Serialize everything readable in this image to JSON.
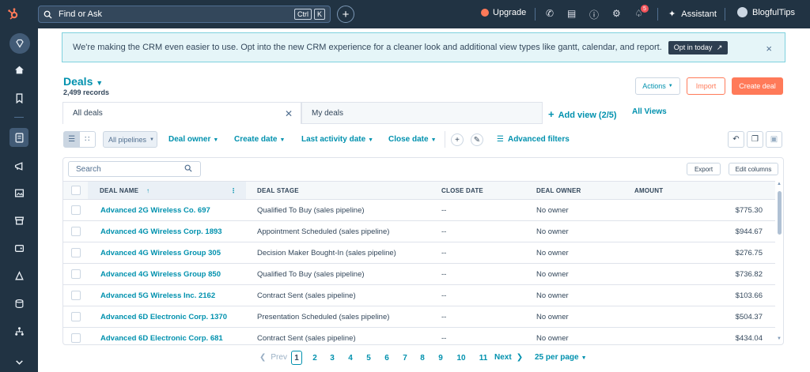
{
  "topbar": {
    "search_placeholder": "Find or Ask",
    "shortcut_ctrl": "Ctrl",
    "shortcut_k": "K",
    "upgrade_label": "Upgrade",
    "notification_count": "5",
    "assistant_label": "Assistant",
    "account_name": "BlogfulTips"
  },
  "banner": {
    "text": "We're making the CRM even easier to use. Opt into the new CRM experience for a cleaner look and additional view types like gantt, calendar, and report.",
    "button_label": "Opt in today",
    "close": "×"
  },
  "header": {
    "title": "Deals",
    "records": "2,499 records",
    "actions_label": "Actions",
    "import_label": "Import",
    "create_label": "Create deal"
  },
  "views": {
    "tab_all": "All deals",
    "tab_my": "My deals",
    "add_view": "Add view (2/5)",
    "all_views": "All Views"
  },
  "filters": {
    "pipelines": "All pipelines",
    "deal_owner": "Deal owner",
    "create_date": "Create date",
    "last_activity": "Last activity date",
    "close_date": "Close date",
    "advanced": "Advanced filters"
  },
  "table": {
    "search_placeholder": "Search",
    "export_label": "Export",
    "edit_columns_label": "Edit columns",
    "columns": [
      "DEAL NAME",
      "DEAL STAGE",
      "CLOSE DATE",
      "DEAL OWNER",
      "AMOUNT"
    ],
    "rows": [
      {
        "name": "Advanced 2G Wireless Co. 697",
        "stage": "Qualified To Buy (sales pipeline)",
        "close": "--",
        "owner": "No owner",
        "amount": "$775.30"
      },
      {
        "name": "Advanced 4G Wireless Corp. 1893",
        "stage": "Appointment Scheduled (sales pipeline)",
        "close": "--",
        "owner": "No owner",
        "amount": "$944.67"
      },
      {
        "name": "Advanced 4G Wireless Group 305",
        "stage": "Decision Maker Bought-In (sales pipeline)",
        "close": "--",
        "owner": "No owner",
        "amount": "$276.75"
      },
      {
        "name": "Advanced 4G Wireless Group 850",
        "stage": "Qualified To Buy (sales pipeline)",
        "close": "--",
        "owner": "No owner",
        "amount": "$736.82"
      },
      {
        "name": "Advanced 5G Wireless Inc. 2162",
        "stage": "Contract Sent (sales pipeline)",
        "close": "--",
        "owner": "No owner",
        "amount": "$103.66"
      },
      {
        "name": "Advanced 6D Electronic Corp. 1370",
        "stage": "Presentation Scheduled (sales pipeline)",
        "close": "--",
        "owner": "No owner",
        "amount": "$504.37"
      },
      {
        "name": "Advanced 6D Electronic Corp. 681",
        "stage": "Contract Sent (sales pipeline)",
        "close": "--",
        "owner": "No owner",
        "amount": "$434.04"
      }
    ]
  },
  "pagination": {
    "prev": "Prev",
    "pages": [
      "1",
      "2",
      "3",
      "4",
      "5",
      "6",
      "7",
      "8",
      "9",
      "10",
      "11"
    ],
    "current": "1",
    "next": "Next",
    "per_page": "25 per page"
  },
  "colors": {
    "nav_bg": "#213343",
    "link": "#0091ae",
    "accent": "#ff7a59",
    "banner_bg": "#e5f5f8"
  }
}
